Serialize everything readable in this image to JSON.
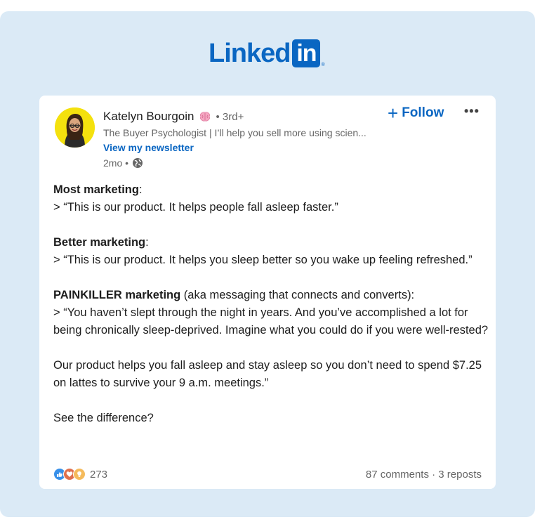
{
  "logo": {
    "text": "Linked",
    "box": "in",
    "reg": "®"
  },
  "post": {
    "author": "Katelyn Bourgoin",
    "badge_icon": "brain-emoji-icon",
    "degree": "• 3rd+",
    "headline": "The Buyer Psychologist | I’ll help you sell more using scien...",
    "newsletter_link": "View my newsletter",
    "time": "2mo •",
    "visibility_icon": "globe-icon",
    "follow_label": "Follow",
    "more_label": "•••",
    "content": {
      "p1_bold": "Most marketing",
      "p1_colon": ":",
      "p1_quote": "> “This is our product. It helps people fall asleep faster.”",
      "p2_bold": "Better marketing",
      "p2_colon": ":",
      "p2_quote": "> “This is our product. It helps you sleep better so you wake up feeling refreshed.”",
      "p3_bold": "PAINKILLER marketing",
      "p3_rest": " (aka messaging that connects and converts):",
      "p3_quote": "> “You haven’t slept through the night in years. And you’ve accomplished a lot for being chronically sleep-deprived. Imagine what you could do if you were well-rested?",
      "p4": "Our product helps you fall asleep and stay asleep so you don’t need to spend $7.25 on lattes to survive your 9 a.m. meetings.”",
      "p5": "See the difference?"
    },
    "reaction_count": "273",
    "stats": "87 comments · 3 reposts"
  },
  "colors": {
    "brand": "#0a66c2",
    "frame_bg": "#dbeaf6",
    "avatar_bg": "#f4e10e"
  }
}
